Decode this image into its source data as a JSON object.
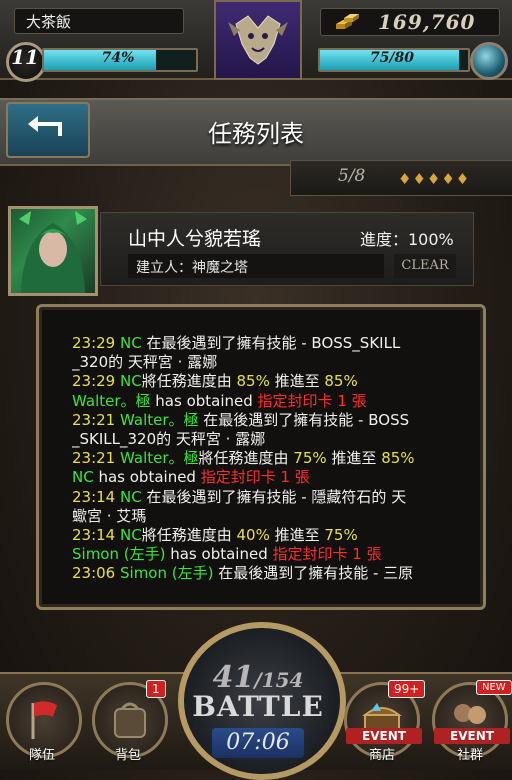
{
  "hud": {
    "player_name": "大茶飯",
    "gold": "169,760",
    "level": "11",
    "exp_percent_label": "74%",
    "exp_fraction": 0.74,
    "stamina_label": "75/80",
    "stamina_fraction": 0.9375
  },
  "header": {
    "title": "任務列表",
    "progress": "5/8",
    "pips": "♦♦♦♦♦"
  },
  "quest": {
    "name": "山中人兮貌若瑤",
    "progress_label": "進度：100%",
    "creator": "建立人：神魔之塔",
    "status": "CLEAR"
  },
  "log": [
    [
      {
        "c": "t",
        "s": "23:29 "
      },
      {
        "c": "n",
        "s": "NC"
      },
      {
        "c": "",
        "s": " 在最後遇到了擁有技能 - BOSS_SKILL"
      }
    ],
    [
      {
        "c": "",
        "s": "_320的 天秤宮 · 露娜"
      }
    ],
    [
      {
        "c": "t",
        "s": "23:29 "
      },
      {
        "c": "n",
        "s": "NC"
      },
      {
        "c": "",
        "s": "將任務進度由 "
      },
      {
        "c": "p",
        "s": "85%"
      },
      {
        "c": "",
        "s": " 推進至 "
      },
      {
        "c": "p",
        "s": "85%"
      }
    ],
    [
      {
        "c": "n",
        "s": "Walter。極"
      },
      {
        "c": "",
        "s": " has obtained "
      },
      {
        "c": "r",
        "s": "指定封印卡 1 張"
      }
    ],
    [
      {
        "c": "t",
        "s": "23:21 "
      },
      {
        "c": "n",
        "s": "Walter。極"
      },
      {
        "c": "",
        "s": " 在最後遇到了擁有技能 - BOSS"
      }
    ],
    [
      {
        "c": "",
        "s": "_SKILL_320的 天秤宮 · 露娜"
      }
    ],
    [
      {
        "c": "t",
        "s": "23:21 "
      },
      {
        "c": "n",
        "s": "Walter。極"
      },
      {
        "c": "",
        "s": "將任務進度由 "
      },
      {
        "c": "p",
        "s": "75%"
      },
      {
        "c": "",
        "s": " 推進至 "
      },
      {
        "c": "p",
        "s": "85%"
      }
    ],
    [
      {
        "c": "n",
        "s": "NC"
      },
      {
        "c": "",
        "s": " has obtained "
      },
      {
        "c": "r",
        "s": "指定封印卡 1 張"
      }
    ],
    [
      {
        "c": "t",
        "s": "23:14 "
      },
      {
        "c": "n",
        "s": "NC"
      },
      {
        "c": "",
        "s": " 在最後遇到了擁有技能 - 隱藏符石的 天"
      }
    ],
    [
      {
        "c": "",
        "s": "蠍宮 · 艾瑪"
      }
    ],
    [
      {
        "c": "t",
        "s": "23:14 "
      },
      {
        "c": "n",
        "s": "NC"
      },
      {
        "c": "",
        "s": "將任務進度由 "
      },
      {
        "c": "p",
        "s": "40%"
      },
      {
        "c": "",
        "s": " 推進至 "
      },
      {
        "c": "p",
        "s": "75%"
      }
    ],
    [
      {
        "c": "n",
        "s": "Simon (左手)"
      },
      {
        "c": "",
        "s": " has obtained "
      },
      {
        "c": "r",
        "s": "指定封印卡 1 張"
      }
    ],
    [
      {
        "c": "t",
        "s": "23:06 "
      },
      {
        "c": "n",
        "s": "Simon (左手)"
      },
      {
        "c": "",
        "s": " 在最後遇到了擁有技能 - 三原"
      }
    ]
  ],
  "nav": {
    "team_label": "隊伍",
    "bag_label": "背包",
    "bag_badge": "1",
    "shop_label": "商店",
    "shop_event": "EVENT",
    "shop_badge": "99+",
    "social_label": "社群",
    "social_event": "EVENT",
    "social_badge": "NEW"
  },
  "battle": {
    "current": "41",
    "total": "/154",
    "label": "BATTLE",
    "timer": "07:06"
  },
  "colors": {
    "timestamp": "#e4e04a",
    "player": "#3de23d",
    "reward": "#ff2c2c",
    "bar": "#3cc5d6"
  }
}
